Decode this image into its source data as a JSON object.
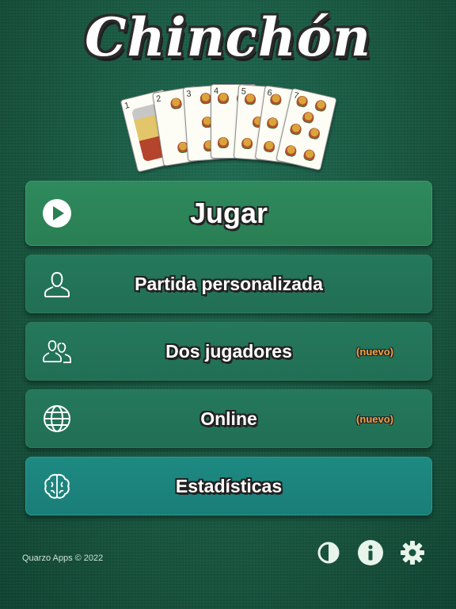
{
  "app": {
    "title": "Chinchón"
  },
  "cards": [
    {
      "number": "1"
    },
    {
      "number": "2"
    },
    {
      "number": "3"
    },
    {
      "number": "4"
    },
    {
      "number": "5"
    },
    {
      "number": "6"
    },
    {
      "number": "7"
    }
  ],
  "menu": {
    "play": {
      "label": "Jugar",
      "icon": "play-icon"
    },
    "custom": {
      "label": "Partida personalizada",
      "icon": "user-icon"
    },
    "two_players": {
      "label": "Dos jugadores",
      "badge": "(nuevo)",
      "icon": "users-icon"
    },
    "online": {
      "label": "Online",
      "badge": "(nuevo)",
      "icon": "globe-icon"
    },
    "stats": {
      "label": "Estadísticas",
      "icon": "brain-icon"
    }
  },
  "footer": {
    "copyright": "Quarzo Apps  © 2022",
    "icons": [
      "contrast-icon",
      "info-icon",
      "gear-icon"
    ]
  },
  "colors": {
    "accent": "#2a7f54",
    "badge": "#f0a24a",
    "stats": "#1a7e77"
  }
}
